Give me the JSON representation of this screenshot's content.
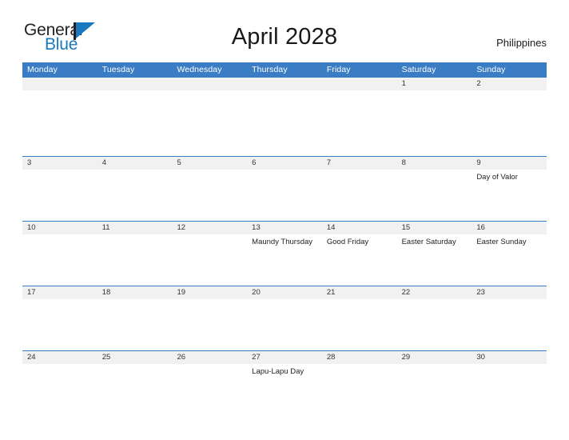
{
  "header": {
    "logo": {
      "word_1": "General",
      "word_2": "Blue",
      "flag_icon": "blue-flag-icon",
      "brand_color": "#1878c0"
    },
    "title": "April 2028",
    "region": "Philippines"
  },
  "calendar": {
    "accent_color": "#3b7dc4",
    "band_color": "#f1f1f1",
    "weekdays": [
      "Monday",
      "Tuesday",
      "Wednesday",
      "Thursday",
      "Friday",
      "Saturday",
      "Sunday"
    ],
    "weeks": [
      {
        "days": [
          {
            "num": "",
            "event": ""
          },
          {
            "num": "",
            "event": ""
          },
          {
            "num": "",
            "event": ""
          },
          {
            "num": "",
            "event": ""
          },
          {
            "num": "",
            "event": ""
          },
          {
            "num": "1",
            "event": ""
          },
          {
            "num": "2",
            "event": ""
          }
        ]
      },
      {
        "days": [
          {
            "num": "3",
            "event": ""
          },
          {
            "num": "4",
            "event": ""
          },
          {
            "num": "5",
            "event": ""
          },
          {
            "num": "6",
            "event": ""
          },
          {
            "num": "7",
            "event": ""
          },
          {
            "num": "8",
            "event": ""
          },
          {
            "num": "9",
            "event": "Day of Valor"
          }
        ]
      },
      {
        "days": [
          {
            "num": "10",
            "event": ""
          },
          {
            "num": "11",
            "event": ""
          },
          {
            "num": "12",
            "event": ""
          },
          {
            "num": "13",
            "event": "Maundy Thursday"
          },
          {
            "num": "14",
            "event": "Good Friday"
          },
          {
            "num": "15",
            "event": "Easter Saturday"
          },
          {
            "num": "16",
            "event": "Easter Sunday"
          }
        ]
      },
      {
        "days": [
          {
            "num": "17",
            "event": ""
          },
          {
            "num": "18",
            "event": ""
          },
          {
            "num": "19",
            "event": ""
          },
          {
            "num": "20",
            "event": ""
          },
          {
            "num": "21",
            "event": ""
          },
          {
            "num": "22",
            "event": ""
          },
          {
            "num": "23",
            "event": ""
          }
        ]
      },
      {
        "days": [
          {
            "num": "24",
            "event": ""
          },
          {
            "num": "25",
            "event": ""
          },
          {
            "num": "26",
            "event": ""
          },
          {
            "num": "27",
            "event": "Lapu-Lapu Day"
          },
          {
            "num": "28",
            "event": ""
          },
          {
            "num": "29",
            "event": ""
          },
          {
            "num": "30",
            "event": ""
          }
        ]
      }
    ]
  }
}
